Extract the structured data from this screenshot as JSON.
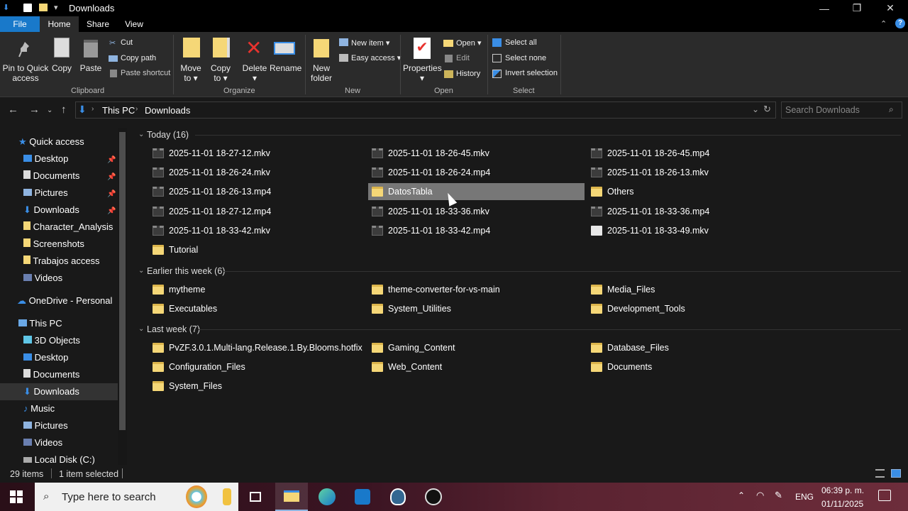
{
  "window": {
    "title": "Downloads",
    "minimize": "—",
    "maximize": "❐",
    "close": "✕"
  },
  "tabs": [
    "File",
    "Home",
    "Share",
    "View"
  ],
  "ribbon": {
    "clipboard": {
      "label": "Clipboard",
      "pin": "Pin to Quick access",
      "copy": "Copy",
      "paste": "Paste",
      "cut": "Cut",
      "copy_path": "Copy path",
      "paste_shortcut": "Paste shortcut"
    },
    "organize": {
      "label": "Organize",
      "move_to": "Move to",
      "copy_to": "Copy to",
      "delete": "Delete",
      "rename": "Rename"
    },
    "new": {
      "label": "New",
      "new_folder": "New folder",
      "new_item": "New item",
      "easy_access": "Easy access"
    },
    "open": {
      "label": "Open",
      "properties": "Properties",
      "open": "Open",
      "edit": "Edit",
      "history": "History"
    },
    "select": {
      "label": "Select",
      "select_all": "Select all",
      "select_none": "Select none",
      "invert": "Invert selection"
    }
  },
  "address": {
    "root": "This PC",
    "folder": "Downloads",
    "search_placeholder": "Search Downloads"
  },
  "nav": {
    "quick_access": "Quick access",
    "qa_items": [
      "Desktop",
      "Documents",
      "Pictures",
      "Downloads",
      "Character_Analysis",
      "Screenshots",
      "Trabajos access",
      "Videos"
    ],
    "onedrive": "OneDrive - Personal",
    "this_pc": "This PC",
    "pc_items": [
      "3D Objects",
      "Desktop",
      "Documents",
      "Downloads",
      "Music",
      "Pictures",
      "Videos",
      "Local Disk (C:)"
    ]
  },
  "groups": {
    "today": "Today (16)",
    "earlier": "Earlier this week (6)",
    "last": "Last week (7)"
  },
  "today_items": [
    {
      "name": "2025-11-01 18-27-12.mkv",
      "type": "video"
    },
    {
      "name": "2025-11-01 18-26-45.mkv",
      "type": "video"
    },
    {
      "name": "2025-11-01 18-26-45.mp4",
      "type": "video"
    },
    {
      "name": "2025-11-01 18-26-24.mkv",
      "type": "video"
    },
    {
      "name": "2025-11-01 18-26-24.mp4",
      "type": "video"
    },
    {
      "name": "2025-11-01 18-26-13.mkv",
      "type": "video"
    },
    {
      "name": "2025-11-01 18-26-13.mp4",
      "type": "video"
    },
    {
      "name": "DatosTabla",
      "type": "folder"
    },
    {
      "name": "Others",
      "type": "folder"
    },
    {
      "name": "2025-11-01 18-27-12.mp4",
      "type": "video"
    },
    {
      "name": "2025-11-01 18-33-36.mkv",
      "type": "video"
    },
    {
      "name": "2025-11-01 18-33-36.mp4",
      "type": "video"
    },
    {
      "name": "2025-11-01 18-33-42.mkv",
      "type": "video"
    },
    {
      "name": "2025-11-01 18-33-42.mp4",
      "type": "video"
    },
    {
      "name": "2025-11-01 18-33-49.mkv",
      "type": "doc"
    },
    {
      "name": "Tutorial",
      "type": "folder"
    }
  ],
  "earlier_items": [
    {
      "name": "mytheme"
    },
    {
      "name": "theme-converter-for-vs-main"
    },
    {
      "name": "Media_Files"
    },
    {
      "name": "Executables"
    },
    {
      "name": "System_Utilities"
    },
    {
      "name": "Development_Tools"
    }
  ],
  "last_items": [
    {
      "name": "PvZF.3.0.1.Multi-lang.Release.1.By.Blooms.hotfix"
    },
    {
      "name": "Gaming_Content"
    },
    {
      "name": "Database_Files"
    },
    {
      "name": "Configuration_Files"
    },
    {
      "name": "Web_Content"
    },
    {
      "name": "Documents"
    },
    {
      "name": "System_Files"
    }
  ],
  "status": {
    "count": "29 items",
    "selected": "1 item selected"
  },
  "taskbar": {
    "search_placeholder": "Type here to search",
    "lang": "ENG",
    "time": "06:39 p. m.",
    "date": "01/11/2025"
  },
  "colors": {
    "accent": "#1979ca",
    "selected": "#777777"
  }
}
